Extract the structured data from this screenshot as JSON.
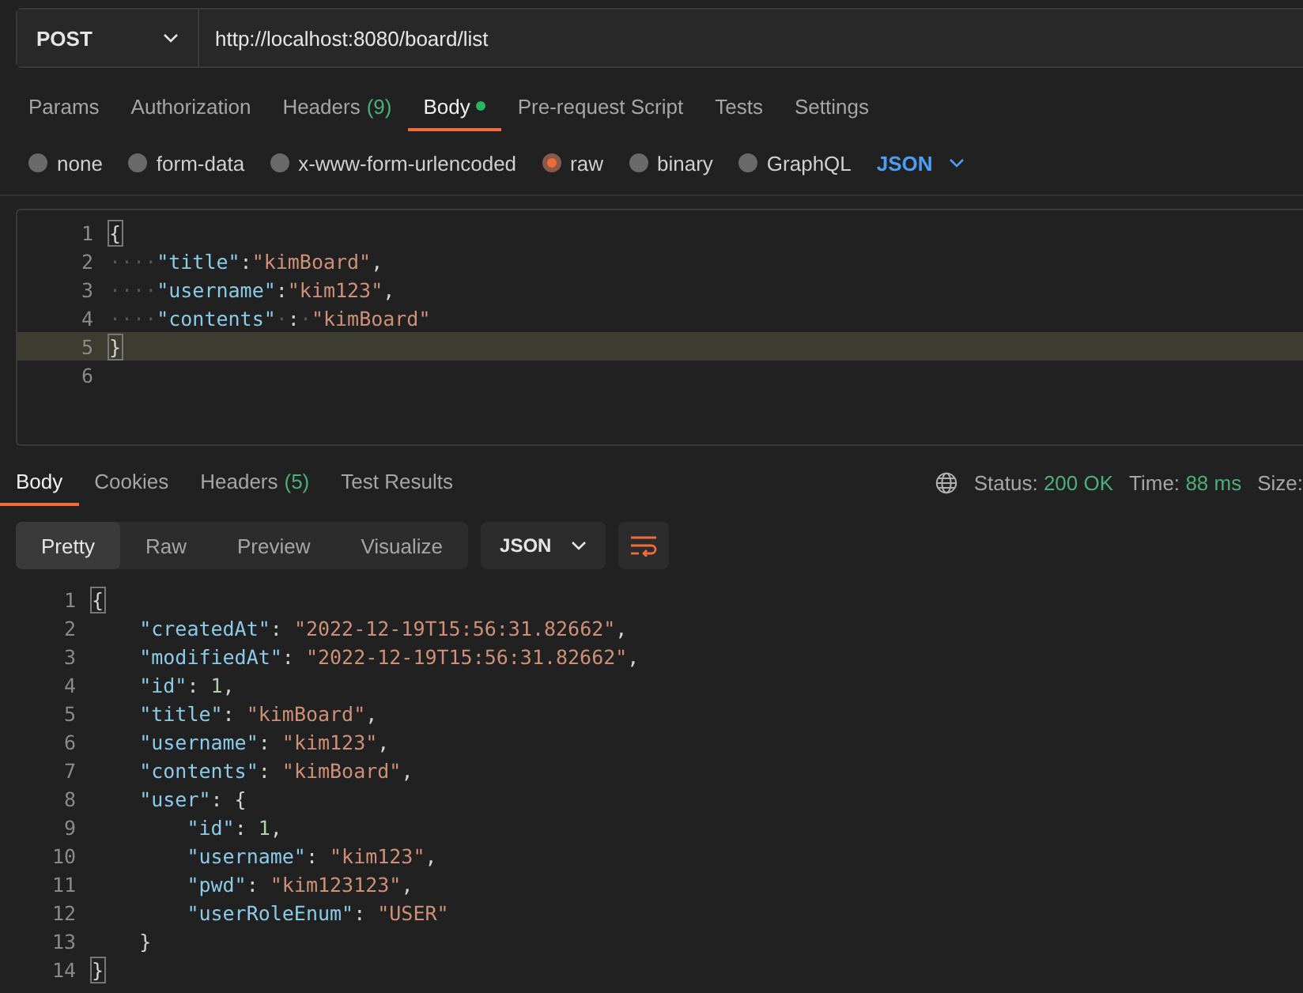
{
  "request": {
    "method": "POST",
    "url": "http://localhost:8080/board/list"
  },
  "request_tabs": [
    {
      "label": "Params",
      "selected": false
    },
    {
      "label": "Authorization",
      "selected": false
    },
    {
      "label": "Headers",
      "count": "(9)",
      "selected": false
    },
    {
      "label": "Body",
      "dot": true,
      "selected": true
    },
    {
      "label": "Pre-request Script",
      "selected": false
    },
    {
      "label": "Tests",
      "selected": false
    },
    {
      "label": "Settings",
      "selected": false
    }
  ],
  "body_types": [
    {
      "label": "none",
      "selected": false
    },
    {
      "label": "form-data",
      "selected": false
    },
    {
      "label": "x-www-form-urlencoded",
      "selected": false
    },
    {
      "label": "raw",
      "selected": true
    },
    {
      "label": "binary",
      "selected": false
    },
    {
      "label": "GraphQL",
      "selected": false
    }
  ],
  "body_format": "JSON",
  "request_body": [
    {
      "number": "1",
      "current": false,
      "tokens": [
        {
          "kind": "bracket",
          "text": "{"
        }
      ]
    },
    {
      "number": "2",
      "current": false,
      "tokens": [
        {
          "kind": "ws",
          "text": "····"
        },
        {
          "kind": "key",
          "text": "\"title\""
        },
        {
          "kind": "punct",
          "text": ":"
        },
        {
          "kind": "string",
          "text": "\"kimBoard\""
        },
        {
          "kind": "punct",
          "text": ","
        }
      ]
    },
    {
      "number": "3",
      "current": false,
      "tokens": [
        {
          "kind": "ws",
          "text": "····"
        },
        {
          "kind": "key",
          "text": "\"username\""
        },
        {
          "kind": "punct",
          "text": ":"
        },
        {
          "kind": "string",
          "text": "\"kim123\""
        },
        {
          "kind": "punct",
          "text": ","
        }
      ]
    },
    {
      "number": "4",
      "current": false,
      "tokens": [
        {
          "kind": "ws",
          "text": "····"
        },
        {
          "kind": "key",
          "text": "\"contents\""
        },
        {
          "kind": "ws",
          "text": "·"
        },
        {
          "kind": "punct",
          "text": ":"
        },
        {
          "kind": "ws",
          "text": "·"
        },
        {
          "kind": "string",
          "text": "\"kimBoard\""
        }
      ]
    },
    {
      "number": "5",
      "current": true,
      "tokens": [
        {
          "kind": "bracket",
          "text": "}"
        }
      ]
    },
    {
      "number": "6",
      "current": false
    }
  ],
  "response_tabs": [
    {
      "label": "Body",
      "selected": true
    },
    {
      "label": "Cookies",
      "selected": false
    },
    {
      "label": "Headers",
      "count": "(5)",
      "selected": false
    },
    {
      "label": "Test Results",
      "selected": false
    }
  ],
  "status": [
    {
      "label": "Status:",
      "value": "200 OK"
    },
    {
      "label": "Time:",
      "value": "88 ms"
    },
    {
      "label": "Size:"
    }
  ],
  "view_modes": [
    {
      "label": "Pretty",
      "selected": true
    },
    {
      "label": "Raw",
      "selected": false
    },
    {
      "label": "Preview",
      "selected": false
    },
    {
      "label": "Visualize",
      "selected": false
    }
  ],
  "response_format": "JSON",
  "response_body": [
    {
      "number": "1",
      "tokens": [
        {
          "kind": "bracket",
          "text": "{"
        }
      ],
      "children": [
        {
          "number": "2",
          "tokens": [
            {
              "kind": "key",
              "text": "\"createdAt\""
            },
            {
              "kind": "punct",
              "text": ": "
            },
            {
              "kind": "string",
              "text": "\"2022-12-19T15:56:31.82662\""
            },
            {
              "kind": "punct",
              "text": ","
            }
          ]
        },
        {
          "number": "3",
          "tokens": [
            {
              "kind": "key",
              "text": "\"modifiedAt\""
            },
            {
              "kind": "punct",
              "text": ": "
            },
            {
              "kind": "string",
              "text": "\"2022-12-19T15:56:31.82662\""
            },
            {
              "kind": "punct",
              "text": ","
            }
          ]
        },
        {
          "number": "4",
          "tokens": [
            {
              "kind": "key",
              "text": "\"id\""
            },
            {
              "kind": "punct",
              "text": ": "
            },
            {
              "kind": "number",
              "text": "1"
            },
            {
              "kind": "punct",
              "text": ","
            }
          ]
        },
        {
          "number": "5",
          "tokens": [
            {
              "kind": "key",
              "text": "\"title\""
            },
            {
              "kind": "punct",
              "text": ": "
            },
            {
              "kind": "string",
              "text": "\"kimBoard\""
            },
            {
              "kind": "punct",
              "text": ","
            }
          ]
        },
        {
          "number": "6",
          "tokens": [
            {
              "kind": "key",
              "text": "\"username\""
            },
            {
              "kind": "punct",
              "text": ": "
            },
            {
              "kind": "string",
              "text": "\"kim123\""
            },
            {
              "kind": "punct",
              "text": ","
            }
          ]
        },
        {
          "number": "7",
          "tokens": [
            {
              "kind": "key",
              "text": "\"contents\""
            },
            {
              "kind": "punct",
              "text": ": "
            },
            {
              "kind": "string",
              "text": "\"kimBoard\""
            },
            {
              "kind": "punct",
              "text": ","
            }
          ]
        },
        {
          "number": "8",
          "tokens": [
            {
              "kind": "key",
              "text": "\"user\""
            },
            {
              "kind": "punct",
              "text": ": {"
            }
          ],
          "children": [
            {
              "number": "9",
              "tokens": [
                {
                  "kind": "key",
                  "text": "\"id\""
                },
                {
                  "kind": "punct",
                  "text": ": "
                },
                {
                  "kind": "number",
                  "text": "1"
                },
                {
                  "kind": "punct",
                  "text": ","
                }
              ]
            },
            {
              "number": "10",
              "tokens": [
                {
                  "kind": "key",
                  "text": "\"username\""
                },
                {
                  "kind": "punct",
                  "text": ": "
                },
                {
                  "kind": "string",
                  "text": "\"kim123\""
                },
                {
                  "kind": "punct",
                  "text": ","
                }
              ]
            },
            {
              "number": "11",
              "tokens": [
                {
                  "kind": "key",
                  "text": "\"pwd\""
                },
                {
                  "kind": "punct",
                  "text": ": "
                },
                {
                  "kind": "string",
                  "text": "\"kim123123\""
                },
                {
                  "kind": "punct",
                  "text": ","
                }
              ]
            },
            {
              "number": "12",
              "tokens": [
                {
                  "kind": "key",
                  "text": "\"userRoleEnum\""
                },
                {
                  "kind": "punct",
                  "text": ": "
                },
                {
                  "kind": "string",
                  "text": "\"USER\""
                }
              ]
            }
          ]
        },
        {
          "number": "13",
          "tokens": [
            {
              "kind": "punct",
              "text": "}"
            }
          ]
        }
      ]
    },
    {
      "number": "14",
      "tokens": [
        {
          "kind": "bracket",
          "text": "}"
        }
      ]
    }
  ]
}
